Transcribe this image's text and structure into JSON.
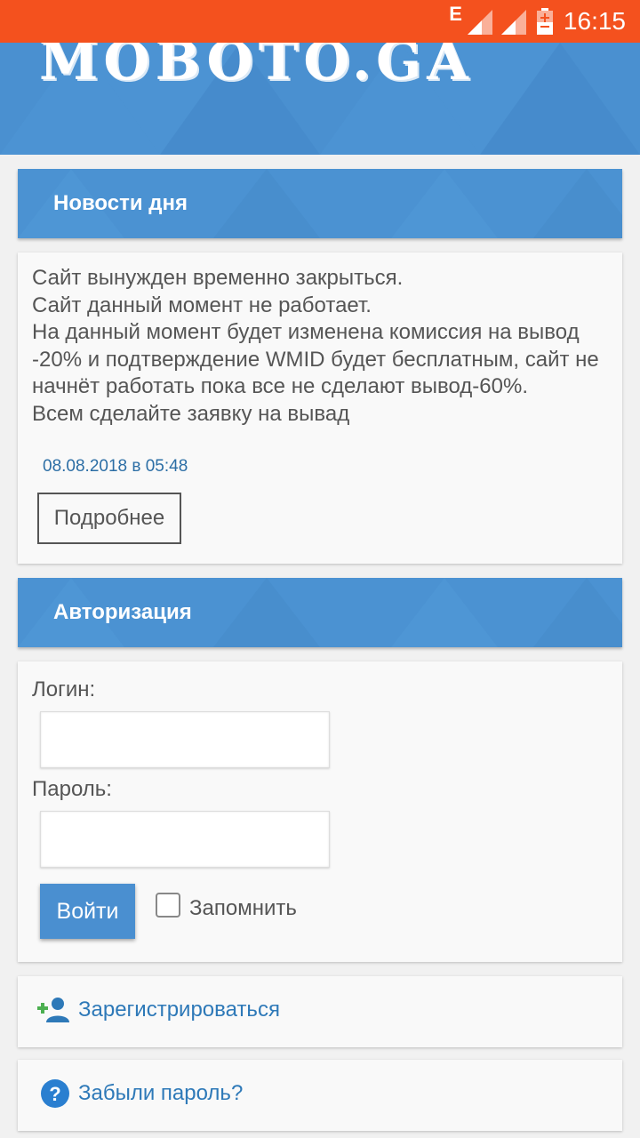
{
  "status_bar": {
    "network": "E",
    "time": "16:15",
    "color": "#f4511e"
  },
  "header": {
    "logo_text": "MOBOTO.GA",
    "color": "#4a90d0"
  },
  "news": {
    "title": "Новости дня",
    "lines": [
      "Сайт вынужден временно закрыться.",
      "Сайт данный момент не работает.",
      "На данный момент будет изменена комиссия на вывод -20% и подтверждение WMID будет бесплатным, сайт не начнёт работать пока все не сделают вывод-60%.",
      "Всем сделайте заявку на вывад"
    ],
    "date": "08.08.2018 в 05:48",
    "more_label": "Подробнее"
  },
  "auth": {
    "title": "Авторизация",
    "login_label": "Логин:",
    "login_value": "",
    "password_label": "Пароль:",
    "password_value": "",
    "submit_label": "Войти",
    "remember_label": "Запомнить",
    "remember_checked": false
  },
  "links": {
    "register_label": "Зарегистрироваться",
    "register_icon": "add-user-icon",
    "forgot_label": "Забыли пароль?",
    "forgot_icon": "help-icon"
  },
  "colors": {
    "accent": "#4a90d0",
    "link": "#2e79b8",
    "text": "#555555"
  }
}
